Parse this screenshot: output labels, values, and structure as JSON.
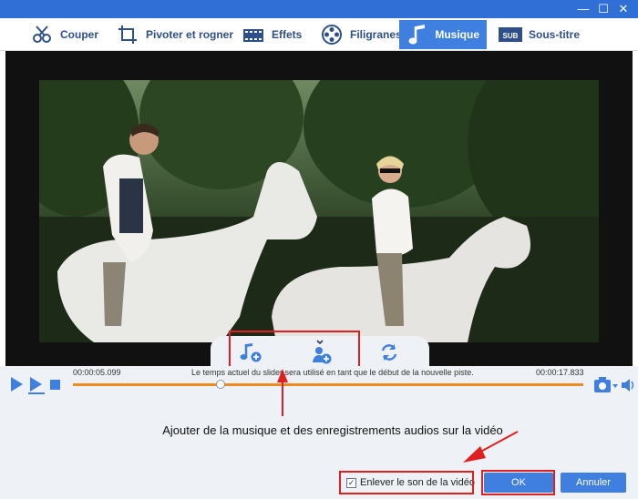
{
  "window": {
    "min_label": "—",
    "max_label": "☐",
    "close_label": "✕"
  },
  "tabs": [
    {
      "label": "Couper",
      "icon": "cut-icon"
    },
    {
      "label": "Pivoter et rogner",
      "icon": "rotate-crop-icon"
    },
    {
      "label": "Effets",
      "icon": "effects-icon"
    },
    {
      "label": "Filigranes",
      "icon": "watermark-icon"
    },
    {
      "label": "Musique",
      "icon": "music-icon",
      "active": true
    },
    {
      "label": "Sous-titre",
      "icon": "subtitle-icon"
    }
  ],
  "player": {
    "current_time": "00:00:05.099",
    "total_time": "00:00:17.833",
    "slider_note": "Le temps actuel du slider sera utilisé en tant que le début de la nouvelle piste.",
    "progress": 0.29
  },
  "music_toolbar": {
    "add_music_icon": "add-music-icon",
    "add_recording_icon": "add-recording-icon",
    "replace_icon": "refresh-icon"
  },
  "caption": "Ajouter de la musique et des enregistrements audios sur la vidéo",
  "footer": {
    "mute_label": "Enlever le son de la vidéo",
    "mute_checked": true,
    "ok_label": "OK",
    "cancel_label": "Annuler"
  },
  "colors": {
    "accent": "#3f7fe0",
    "titlebar": "#2f6fd6",
    "progress": "#f08a1e",
    "highlight": "#e02020"
  }
}
